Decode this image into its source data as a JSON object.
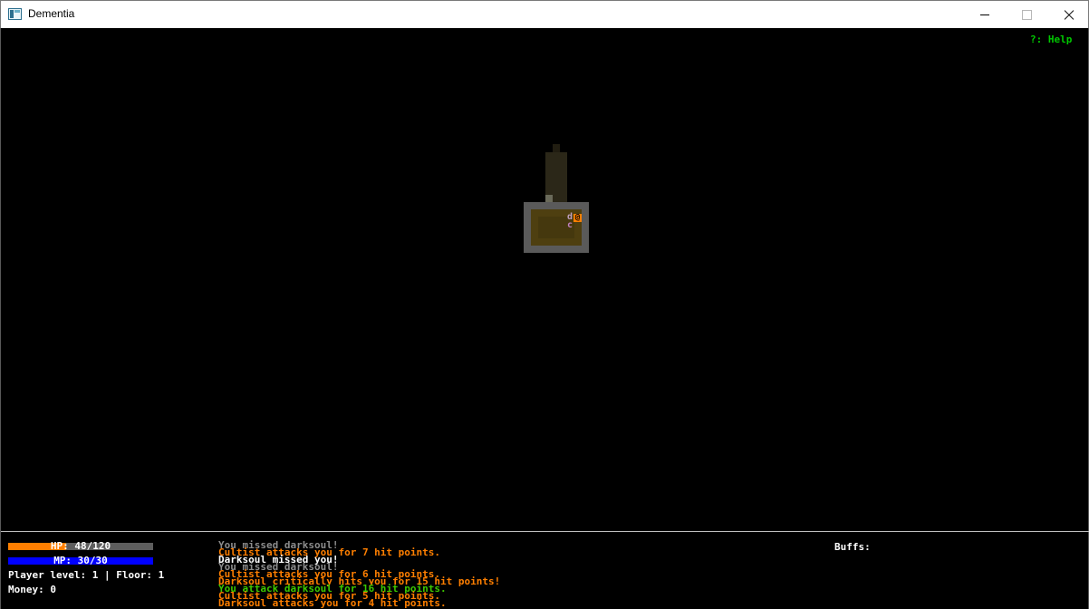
{
  "window": {
    "title": "Dementia"
  },
  "help_hint": "?: Help",
  "hud": {
    "hp": {
      "label": "HP: 48/120",
      "current": 48,
      "max": 120,
      "color": "#ff7f00"
    },
    "mp": {
      "label": "MP: 30/30",
      "current": 30,
      "max": 30,
      "color": "#0000ff"
    },
    "level_floor": "Player level: 1 | Floor: 1",
    "money": "Money: 0",
    "buffs_label": "Buffs:"
  },
  "map": {
    "player_glyph": "@",
    "darksoul_glyph": "d",
    "cultist_glyph": "c",
    "colors": {
      "floor": "#4e3f10",
      "wall": "#5a5a5a",
      "corridor": "#2e2a1c",
      "player": "#ff7f00",
      "monster": "#c080c0"
    }
  },
  "log": [
    {
      "text": "You missed darksoul!",
      "color": "#8c8c8c"
    },
    {
      "text": "Cultist attacks you for 7 hit points.",
      "color": "#ff7f00"
    },
    {
      "text": "Darksoul missed you!",
      "color": "#ffffff"
    },
    {
      "text": "You missed darksoul!",
      "color": "#8c8c8c"
    },
    {
      "text": "Cultist attacks you for 6 hit points.",
      "color": "#ff7f00"
    },
    {
      "text": "Darksoul critically hits you for 15 hit points!",
      "color": "#ff7f00"
    },
    {
      "text": "You attack darksoul for 16 hit points.",
      "color": "#3cc800"
    },
    {
      "text": "Cultist attacks you for 5 hit points.",
      "color": "#ff7f00"
    },
    {
      "text": "Darksoul attacks you for 4 hit points.",
      "color": "#ff7f00"
    }
  ]
}
